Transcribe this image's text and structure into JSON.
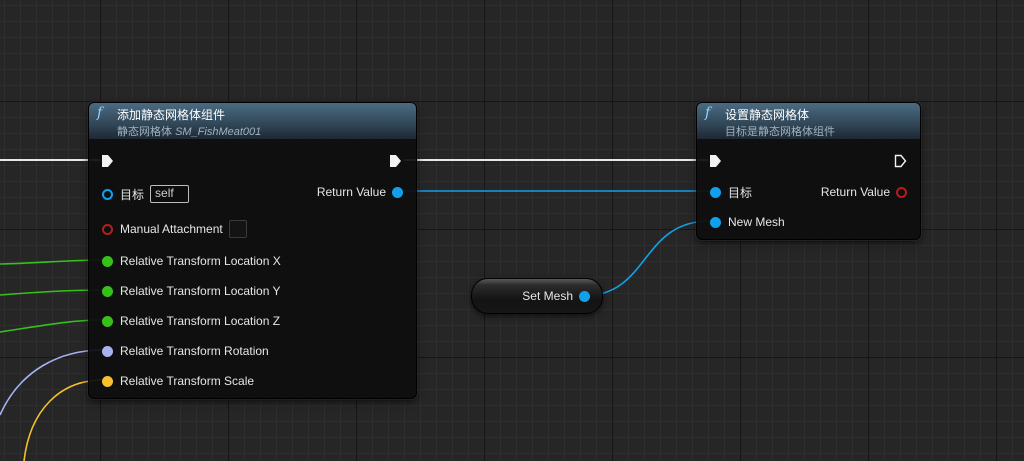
{
  "colors": {
    "exec_wire": "#e8e8e8",
    "object_pin": "#12a0ea",
    "float_pin": "#36c11a",
    "rotator_pin": "#a8b2f2",
    "vector_pin": "#f6c12a",
    "bool_pin": "#b51d1d",
    "header_blue": "#3e5b70"
  },
  "node_add": {
    "icon": "function-icon",
    "title": "添加静态网格体组件",
    "subtitle_prefix": "静态网格体",
    "subtitle_asset": "SM_FishMeat001",
    "target_label": "目标",
    "target_value": "self",
    "return_label": "Return Value",
    "manual_attachment_label": "Manual Attachment",
    "loc_x_label": "Relative Transform Location X",
    "loc_y_label": "Relative Transform Location Y",
    "loc_z_label": "Relative Transform Location Z",
    "rotation_label": "Relative Transform Rotation",
    "scale_label": "Relative Transform Scale"
  },
  "node_set": {
    "icon": "function-icon",
    "title": "设置静态网格体",
    "subtitle": "目标是静态网格体组件",
    "target_label": "目标",
    "return_label": "Return Value",
    "new_mesh_label": "New Mesh"
  },
  "variable_node": {
    "label": "Set Mesh"
  }
}
